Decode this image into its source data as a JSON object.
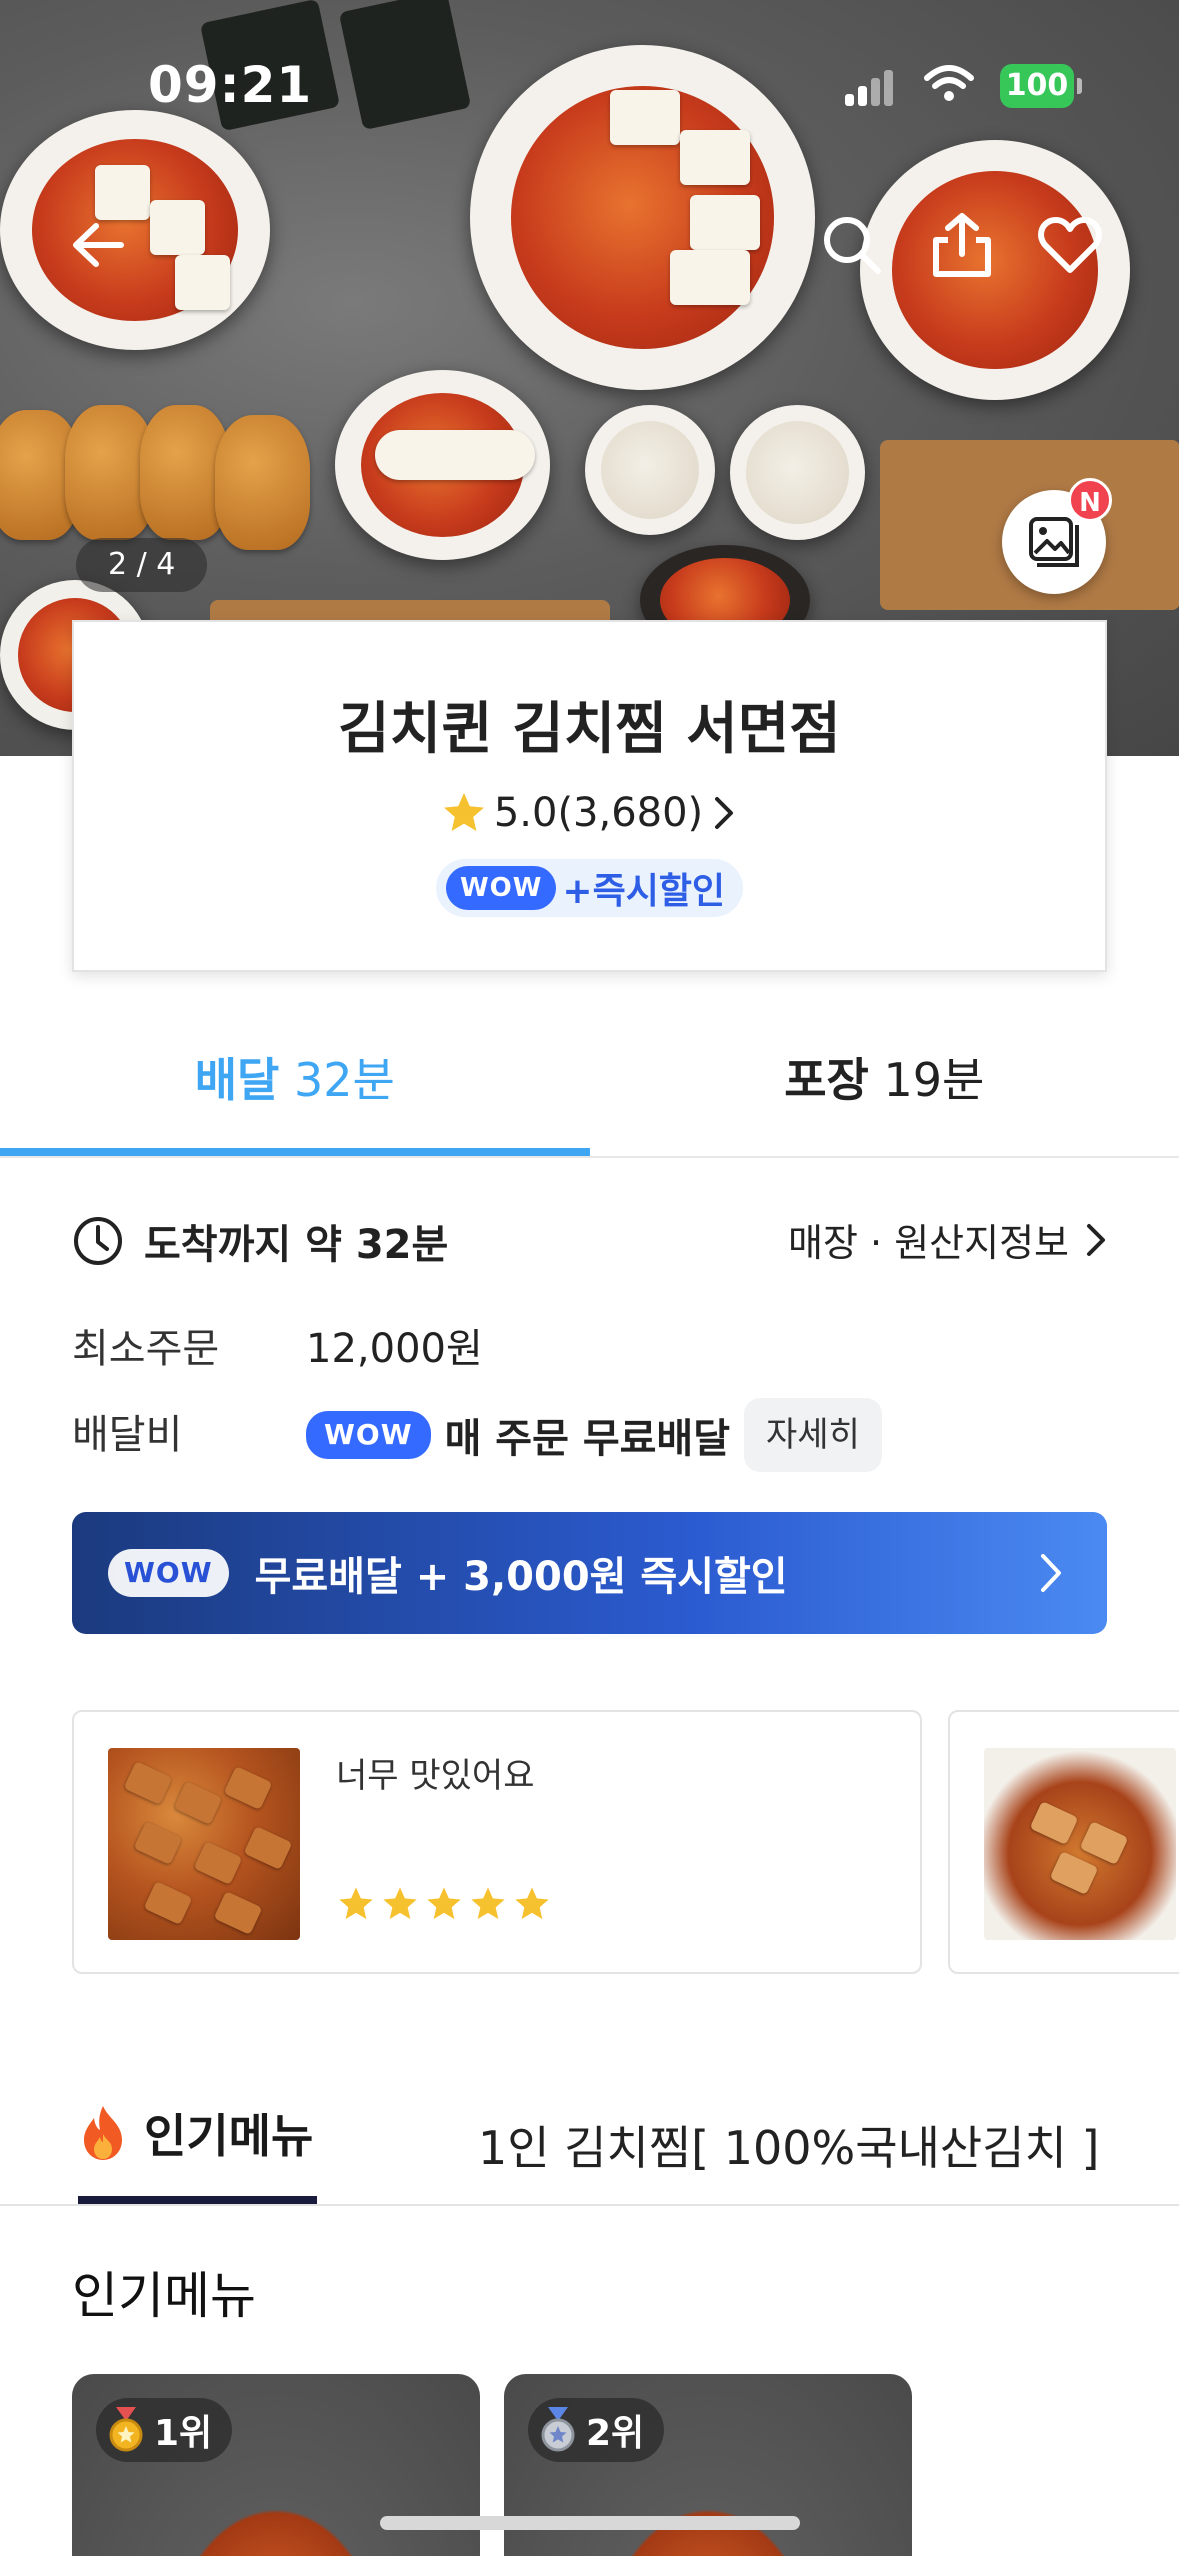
{
  "status_bar": {
    "time": "09:21",
    "battery": "100"
  },
  "hero": {
    "image_counter": "2 / 4",
    "gallery_badge": "N"
  },
  "store": {
    "name": "김치퀸 김치찜 서면점",
    "rating": "5.0(3,680)",
    "wow_label": "WOW",
    "promo": "+즉시할인"
  },
  "order_tabs": [
    {
      "label": "배달",
      "time": "32분",
      "active": true
    },
    {
      "label": "포장",
      "time": "19분",
      "active": false
    }
  ],
  "info": {
    "arrival": "도착까지 약 32분",
    "origin_link": "매장 · 원산지정보",
    "min_order_label": "최소주문",
    "min_order_value": "12,000원",
    "delivery_fee_label": "배달비",
    "wow_label": "WOW",
    "delivery_fee_value": "매 주문 무료배달",
    "detail_button": "자세히"
  },
  "banner": {
    "wow_label": "WOW",
    "text": "무료배달 + 3,000원 즉시할인"
  },
  "reviews": [
    {
      "text": "너무 맛있어요",
      "stars": 5
    },
    {
      "text": "",
      "stars": 0
    }
  ],
  "menu_tabs": [
    {
      "label": "인기메뉴",
      "active": true
    },
    {
      "label": "1인 김치찜[ 100%국내산김치 ]",
      "active": false
    }
  ],
  "section_title": "인기메뉴",
  "popular": [
    {
      "rank": "1위"
    },
    {
      "rank": "2위"
    }
  ],
  "colors": {
    "accent": "#3fa6f4",
    "wow": "#346aff",
    "star": "#f6c12f",
    "badge": "#f0434f"
  }
}
